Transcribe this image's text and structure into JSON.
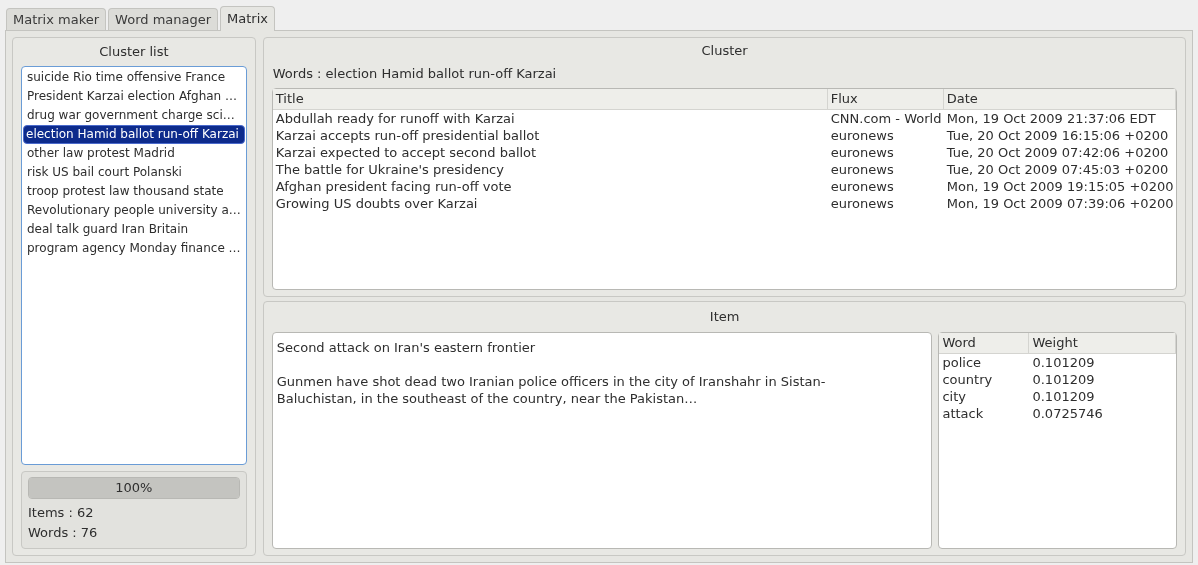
{
  "tabs": [
    {
      "label": "Matrix maker",
      "selected": false
    },
    {
      "label": "Word manager",
      "selected": false
    },
    {
      "label": "Matrix",
      "selected": true
    }
  ],
  "cluster_list": {
    "title": "Cluster list",
    "items": [
      {
        "label": "suicide Rio time offensive France",
        "selected": false
      },
      {
        "label": "President Karzai election Afghan …",
        "selected": false
      },
      {
        "label": "drug war government charge sci…",
        "selected": false
      },
      {
        "label": "election Hamid ballot run-off Karzai",
        "selected": true
      },
      {
        "label": "other law protest Madrid",
        "selected": false
      },
      {
        "label": "risk US bail court Polanski",
        "selected": false
      },
      {
        "label": "troop protest law thousand state",
        "selected": false
      },
      {
        "label": "Revolutionary people university a…",
        "selected": false
      },
      {
        "label": "deal talk guard Iran Britain",
        "selected": false
      },
      {
        "label": "program agency Monday finance …",
        "selected": false
      }
    ],
    "progress": {
      "level": 1,
      "reading": "100%"
    },
    "items_count": "Items : 62",
    "words_count": "Words : 76"
  },
  "cluster": {
    "title": "Cluster",
    "words": "Words : election Hamid ballot run-off Karzai",
    "table": {
      "columns": [
        "Title",
        "Flux",
        "Date"
      ],
      "rows": [
        [
          "Abdullah ready for runoff with Karzai",
          "CNN.com - World",
          "Mon, 19 Oct 2009 21:37:06 EDT"
        ],
        [
          "Karzai accepts run-off presidential ballot",
          "euronews",
          "Tue, 20 Oct 2009 16:15:06 +0200"
        ],
        [
          "Karzai expected to accept second ballot",
          "euronews",
          "Tue, 20 Oct 2009 07:42:06 +0200"
        ],
        [
          "The battle for Ukraine's presidency",
          "euronews",
          "Tue, 20 Oct 2009 07:45:03 +0200"
        ],
        [
          "Afghan president facing run-off vote",
          "euronews",
          "Mon, 19 Oct 2009 19:15:05 +0200"
        ],
        [
          "Growing US doubts over Karzai",
          "euronews",
          "Mon, 19 Oct 2009 07:39:06 +0200"
        ]
      ]
    }
  },
  "item": {
    "title": "Item",
    "headline": "Second attack on Iran's eastern frontier",
    "body": "Gunmen have shot dead two Iranian police officers in the city of Iranshahr in Sistan-Baluchistan, in the southeast of the country, near the Pakistan…",
    "table": {
      "columns": [
        "Word",
        "Weight"
      ],
      "rows": [
        [
          "police",
          "0.101209"
        ],
        [
          "country",
          "0.101209"
        ],
        [
          "city",
          "0.101209"
        ],
        [
          "attack",
          "0.0725746"
        ]
      ]
    }
  }
}
